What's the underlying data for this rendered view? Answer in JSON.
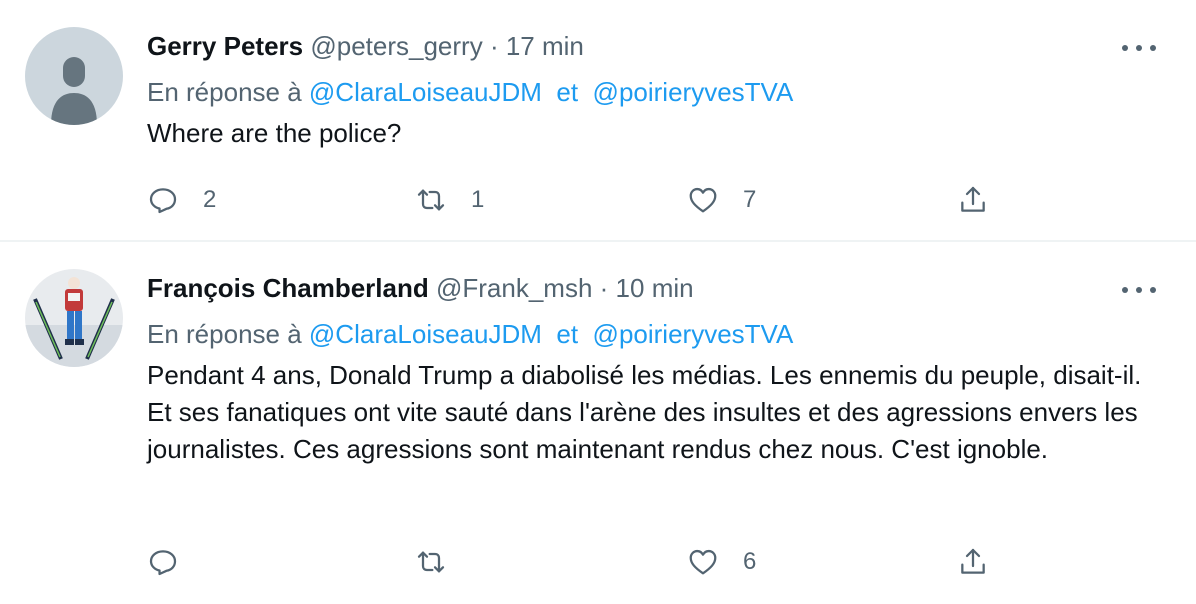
{
  "tweets": [
    {
      "name": "Gerry Peters",
      "handle": "@peters_gerry",
      "separator": "·",
      "time": "17 min",
      "reply_prefix": "En réponse à",
      "mention1": "@ClaraLoiseauJDM",
      "conjunction": "et",
      "mention2": "@poirieryvesTVA",
      "text": "Where are the police?",
      "replies": "2",
      "retweets": "1",
      "likes": "7"
    },
    {
      "name": "François Chamberland",
      "handle": "@Frank_msh",
      "separator": "·",
      "time": "10 min",
      "reply_prefix": "En réponse à",
      "mention1": "@ClaraLoiseauJDM",
      "conjunction": "et",
      "mention2": "@poirieryvesTVA",
      "text": "Pendant 4 ans, Donald Trump a diabolisé les médias. Les ennemis du peuple, disait-il. Et ses fanatiques ont vite sauté dans l'arène des insultes et des agressions envers les journalistes. Ces agressions sont maintenant rendus chez nous. C'est ignoble.",
      "replies": "",
      "retweets": "",
      "likes": "6"
    }
  ],
  "icons": {
    "reply": "reply-icon",
    "retweet": "retweet-icon",
    "like": "heart-icon",
    "share": "share-icon",
    "more": "more-icon"
  },
  "colors": {
    "text": "#0f1419",
    "secondary": "#536471",
    "link": "#1d9bf0",
    "divider": "#eff3f4"
  }
}
